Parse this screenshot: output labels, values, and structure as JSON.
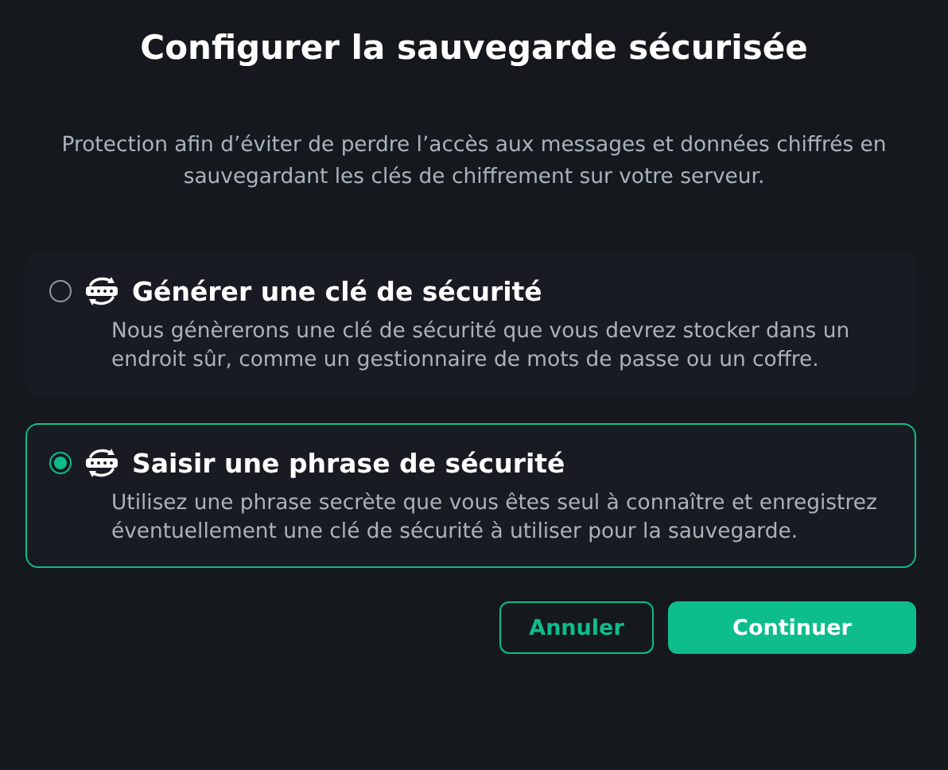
{
  "dialog": {
    "title": "Configurer la sauvegarde sécurisée",
    "description": "Protection afin d’éviter de perdre l’accès aux messages et données chiffrés en sauvegardant les clés de chiffrement sur votre serveur."
  },
  "options": [
    {
      "title": "Générer une clé de sécurité",
      "description": "Nous génèrerons une clé de sécurité que vous devrez stocker dans un endroit sûr, comme un gestionnaire de mots de passe ou un coffre.",
      "selected": false
    },
    {
      "title": "Saisir une phrase de sécurité",
      "description": "Utilisez une phrase secrète que vous êtes seul à connaître et enregistrez éventuellement une clé de sécurité à utiliser pour la sauvegarde.",
      "selected": true
    }
  ],
  "buttons": [
    {
      "label": "Annuler",
      "kind": "secondary"
    },
    {
      "label": "Continuer",
      "kind": "primary"
    }
  ]
}
